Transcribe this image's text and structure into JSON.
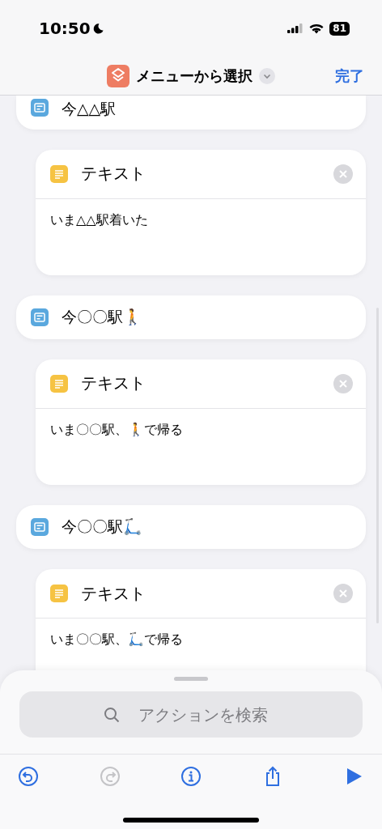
{
  "status_bar": {
    "time": "10:50",
    "focus_on": true,
    "battery": "81"
  },
  "nav_bar": {
    "title": "メニューから選択",
    "done": "完了"
  },
  "actions": [
    {
      "kind": "menu_item",
      "label": "今△△駅",
      "cut": true
    },
    {
      "kind": "text",
      "title": "テキスト",
      "body": "いま△△駅着いた"
    },
    {
      "kind": "menu_item",
      "label": "今〇〇駅🚶",
      "cut": false
    },
    {
      "kind": "text",
      "title": "テキスト",
      "body": "いま〇〇駅、🚶で帰る"
    },
    {
      "kind": "menu_item",
      "label": "今〇〇駅🛴",
      "cut": false
    },
    {
      "kind": "text",
      "title": "テキスト",
      "body": "いま〇〇駅、🛴で帰る"
    }
  ],
  "search": {
    "placeholder": "アクションを検索"
  },
  "toolbar": [
    {
      "kind": "undo",
      "disabled": false
    },
    {
      "kind": "redo",
      "disabled": true
    },
    {
      "kind": "info",
      "disabled": false
    },
    {
      "kind": "share",
      "disabled": false
    },
    {
      "kind": "run",
      "disabled": false
    }
  ]
}
